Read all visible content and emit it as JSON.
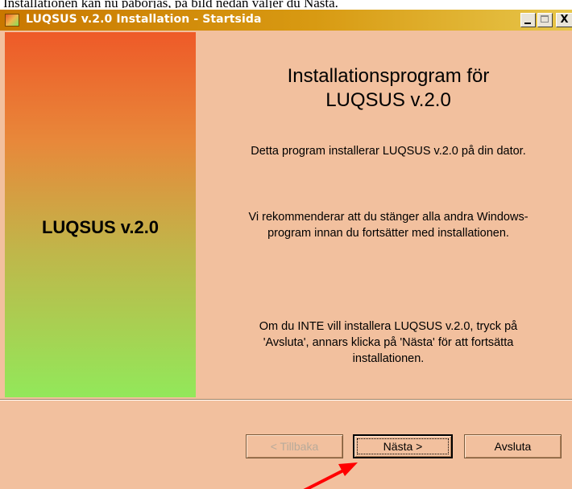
{
  "page_caption": "Installationen kan nu påbörjas, på bild nedan väljer du Nästa.",
  "window": {
    "title": "LUQSUS v.2.0 Installation - Startsida",
    "title_icon": "installer-icon",
    "controls": {
      "minimize_icon": "minimize-icon",
      "maximize_icon": "maximize-icon",
      "close_glyph": "X"
    }
  },
  "sidebar": {
    "product_name": "LUQSUS v.2.0"
  },
  "main": {
    "heading_line1": "Installationsprogram för",
    "heading_line2": "LUQSUS v.2.0",
    "intro": "Detta program installerar LUQSUS v.2.0 på din dator.",
    "recommend_line1": "Vi rekommenderar att du stänger alla andra Windows-",
    "recommend_line2": "program innan du fortsätter med installationen.",
    "cancel_line1": "Om du INTE vill installera LUQSUS v.2.0, tryck på",
    "cancel_line2": "'Avsluta', annars klicka på 'Nästa' för att fortsätta",
    "cancel_line3": "installationen."
  },
  "buttons": {
    "back_label": "< Tillbaka",
    "next_label": "Nästa >",
    "exit_label": "Avsluta"
  },
  "annotation": {
    "color": "#ff0000",
    "icon": "red-arrow-pointer"
  },
  "colors": {
    "title_bar": "#d89a12",
    "body_background": "#f2c09e",
    "sidebar_top": "#ee5a28",
    "sidebar_bottom": "#92e85a"
  }
}
